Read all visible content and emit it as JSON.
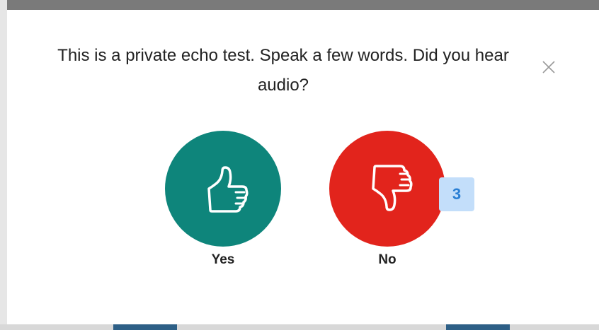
{
  "dialog": {
    "prompt": "This is a private echo test. Speak a few words. Did you hear audio?",
    "close_icon": "close-icon",
    "yes": {
      "label": "Yes",
      "icon": "thumbs-up-icon",
      "color": "#0e857b"
    },
    "no": {
      "label": "No",
      "icon": "thumbs-down-icon",
      "color": "#e2241c"
    },
    "countdown": "3",
    "badge_color": "#c3defa",
    "badge_text_color": "#2a7fd4"
  }
}
